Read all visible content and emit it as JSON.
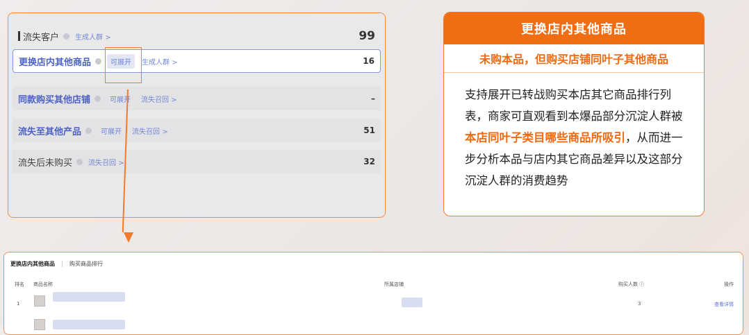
{
  "panel": {
    "header": {
      "title": "流失客户",
      "link": "生成人群 >",
      "value": "99"
    },
    "rows": [
      {
        "title": "更换店内其他商品",
        "tag": "可展开",
        "link": "生成人群 >",
        "value": "16"
      },
      {
        "title": "同款购买其他店铺",
        "tag": "可展开",
        "link": "流失召回 >",
        "value": "–"
      },
      {
        "title": "流失至其他产品",
        "tag": "可展开",
        "link": "流失召回 >",
        "value": "51"
      },
      {
        "title": "流失后未购买",
        "tag": "",
        "link": "流失召回 >",
        "value": "32"
      }
    ]
  },
  "card": {
    "header": "更换店内其他商品",
    "subtitle": "未购本品，但购买店铺同叶子其他商品",
    "desc_part1": "支持展开已转战购买本店其它商品排行列表，商家可直观看到本爆品部分沉淀人群被",
    "desc_highlight": "本店同叶子类目哪些商品所吸引",
    "desc_part2": "，从而进一步分析本品与店内其它商品差异以及这部分沉淀人群的消费趋势"
  },
  "table": {
    "tab_active": "更换店内其他商品",
    "tab_other": "购买商品排行",
    "columns": {
      "rank": "排名",
      "name": "商品名称",
      "shop": "所属店铺",
      "buyers": "购买人数 ⓘ",
      "action": "操作"
    },
    "rows": [
      {
        "rank": "1",
        "buyers": "3",
        "action": "查看详情"
      }
    ]
  },
  "colors": {
    "accent": "#f06d14",
    "link": "#4d63c4"
  }
}
